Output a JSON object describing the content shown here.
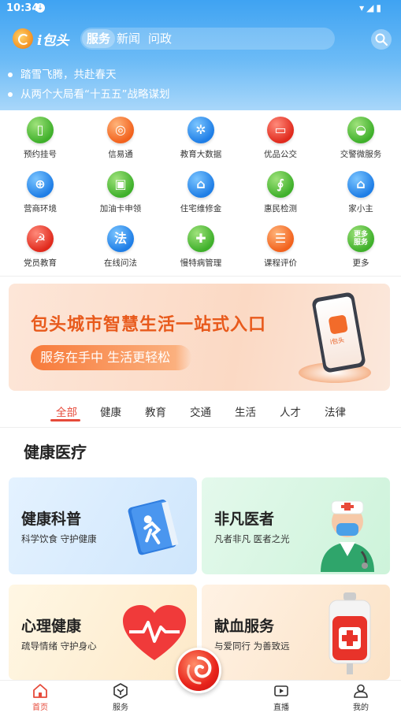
{
  "status_bar": {
    "time": "10:34"
  },
  "header": {
    "logo_text": "i包头",
    "tabs": [
      {
        "label": "服务",
        "active": true
      },
      {
        "label": "新闻",
        "active": false
      },
      {
        "label": "问政",
        "active": false
      }
    ]
  },
  "news": [
    "踏雪飞腾，共赴春天",
    "从两个大局看“十五五”战略谋划"
  ],
  "services": [
    {
      "label": "预约挂号",
      "icon": "phone-icon",
      "color": "green"
    },
    {
      "label": "信易通",
      "icon": "basketball-icon",
      "color": "orange"
    },
    {
      "label": "教育大数据",
      "icon": "education-data-icon",
      "color": "blue"
    },
    {
      "label": "优品公交",
      "icon": "bus-icon",
      "color": "red"
    },
    {
      "label": "交警微服务",
      "icon": "traffic-police-icon",
      "color": "green"
    },
    {
      "label": "营商环境",
      "icon": "globe-icon",
      "color": "blue"
    },
    {
      "label": "加油卡申领",
      "icon": "fuel-icon",
      "color": "green"
    },
    {
      "label": "住宅维修金",
      "icon": "house-money-icon",
      "color": "blue"
    },
    {
      "label": "惠民检测",
      "icon": "stethoscope-icon",
      "color": "green"
    },
    {
      "label": "家小主",
      "icon": "home-icon",
      "color": "blue"
    },
    {
      "label": "党员教育",
      "icon": "party-emblem-icon",
      "color": "red"
    },
    {
      "label": "在线问法",
      "icon": "law-icon",
      "glyph": "法",
      "color": "blue"
    },
    {
      "label": "慢特病管理",
      "icon": "medicine-icon",
      "color": "green"
    },
    {
      "label": "课程评价",
      "icon": "course-icon",
      "color": "orange"
    },
    {
      "label": "更多",
      "icon": "more-services-icon",
      "glyph_lines": [
        "更多",
        "服务"
      ],
      "color": "green"
    }
  ],
  "banner": {
    "title": "包头城市智慧生活一站式入口",
    "subtitle": "服务在手中  生活更轻松",
    "phone_label": "i包头"
  },
  "categories": [
    {
      "label": "全部",
      "active": true
    },
    {
      "label": "健康",
      "active": false
    },
    {
      "label": "教育",
      "active": false
    },
    {
      "label": "交通",
      "active": false
    },
    {
      "label": "生活",
      "active": false
    },
    {
      "label": "人才",
      "active": false
    },
    {
      "label": "法律",
      "active": false
    }
  ],
  "section_title": "健康医疗",
  "cards": [
    {
      "title": "健康科普",
      "subtitle": "科学饮食  守护健康",
      "icon": "health-book-icon"
    },
    {
      "title": "非凡医者",
      "subtitle": "凡者非凡  医者之光",
      "icon": "doctor-icon"
    },
    {
      "title": "心理健康",
      "subtitle": "疏导情绪  守护身心",
      "icon": "heart-pulse-icon"
    },
    {
      "title": "献血服务",
      "subtitle": "与爱同行  为善致远",
      "icon": "blood-bag-icon"
    }
  ],
  "tabbar": [
    {
      "label": "首页",
      "icon": "home-icon",
      "active": true
    },
    {
      "label": "服务",
      "icon": "service-icon",
      "active": false
    },
    {
      "label": "直播",
      "icon": "live-icon",
      "active": false
    },
    {
      "label": "我的",
      "icon": "profile-icon",
      "active": false
    }
  ],
  "colors": {
    "accent": "#e64a3a",
    "header_blue": "#3fa3f2",
    "banner_orange": "#e85a1c"
  }
}
